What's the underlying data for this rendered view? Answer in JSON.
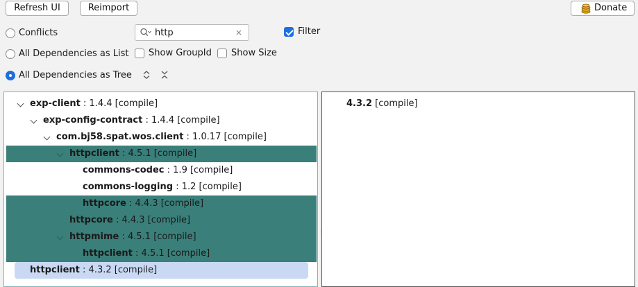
{
  "toolbar": {
    "refresh_label": "Refresh UI",
    "reimport_label": "Reimport",
    "donate_label": "Donate"
  },
  "options": {
    "conflicts_label": "Conflicts",
    "list_label": "All Dependencies as List",
    "tree_label": "All Dependencies as Tree",
    "show_groupid_label": "Show GroupId",
    "show_size_label": "Show Size",
    "filter_label": "Filter",
    "selected_mode": "All Dependencies as Tree",
    "filter_checked": true,
    "show_groupid_checked": false,
    "show_size_checked": false
  },
  "search": {
    "value": "http",
    "placeholder": ""
  },
  "tree": [
    {
      "name": "exp-client",
      "version": " : 1.4.4 [compile]",
      "depth": 0,
      "expanded": true,
      "state": "normal"
    },
    {
      "name": "exp-config-contract",
      "version": " : 1.4.4 [compile]",
      "depth": 1,
      "expanded": true,
      "state": "normal"
    },
    {
      "name": "com.bj58.spat.wos.client",
      "version": " : 1.0.17 [compile]",
      "depth": 2,
      "expanded": true,
      "state": "normal"
    },
    {
      "name": "httpclient",
      "version": " : 4.5.1 [compile]",
      "depth": 3,
      "expanded": true,
      "state": "highlight"
    },
    {
      "name": "commons-codec",
      "version": " : 1.9 [compile]",
      "depth": 4,
      "expanded": false,
      "state": "normal"
    },
    {
      "name": "commons-logging",
      "version": " : 1.2 [compile]",
      "depth": 4,
      "expanded": false,
      "state": "normal"
    },
    {
      "name": "httpcore",
      "version": " : 4.4.3 [compile]",
      "depth": 4,
      "expanded": false,
      "state": "highlight"
    },
    {
      "name": "httpcore",
      "version": " : 4.4.3 [compile]",
      "depth": 3,
      "expanded": false,
      "state": "highlight"
    },
    {
      "name": "httpmime",
      "version": " : 4.5.1 [compile]",
      "depth": 3,
      "expanded": true,
      "state": "highlight"
    },
    {
      "name": "httpclient",
      "version": " : 4.5.1 [compile]",
      "depth": 4,
      "expanded": false,
      "state": "highlight"
    },
    {
      "name": "httpclient",
      "version": " : 4.3.2 [compile]",
      "depth": 0,
      "expanded": false,
      "state": "selected"
    }
  ],
  "detail": {
    "version": "4.3.2",
    "scope": " [compile]"
  },
  "icons": {
    "search": "search-icon",
    "clear": "clear-icon",
    "expand_all": "expand-all-icon",
    "collapse_all": "collapse-all-icon",
    "donate": "coin-stack-icon",
    "chevron": "chevron-down-icon"
  },
  "colors": {
    "accent": "#1e6fe0",
    "highlight_row": "#3a7f7a",
    "selected_row": "#c9d9f3",
    "coin": "#e3a41c"
  }
}
